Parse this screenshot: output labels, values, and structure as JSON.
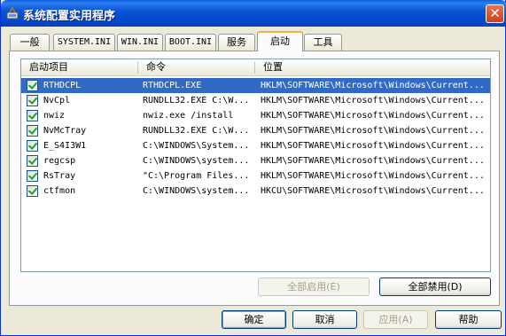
{
  "window": {
    "title": "系统配置实用程序",
    "close_glyph": "✕"
  },
  "tabs": [
    {
      "label": "一般"
    },
    {
      "label": "SYSTEM.INI"
    },
    {
      "label": "WIN.INI"
    },
    {
      "label": "BOOT.INI"
    },
    {
      "label": "服务"
    },
    {
      "label": "启动",
      "active": true
    },
    {
      "label": "工具"
    }
  ],
  "startup_list": {
    "columns": [
      "启动项目",
      "命令",
      "位置"
    ],
    "rows": [
      {
        "item": "RTHDCPL",
        "command": "RTHDCPL.EXE",
        "location": "HKLM\\SOFTWARE\\Microsoft\\Windows\\Current...",
        "checked": true,
        "selected": true
      },
      {
        "item": "NvCpl",
        "command": "RUNDLL32.EXE C:\\W...",
        "location": "HKLM\\SOFTWARE\\Microsoft\\Windows\\Current...",
        "checked": true
      },
      {
        "item": "nwiz",
        "command": "nwiz.exe /install",
        "location": "HKLM\\SOFTWARE\\Microsoft\\Windows\\Current...",
        "checked": true
      },
      {
        "item": "NvMcTray",
        "command": "RUNDLL32.EXE C:\\W...",
        "location": "HKLM\\SOFTWARE\\Microsoft\\Windows\\Current...",
        "checked": true
      },
      {
        "item": "E_S4I3W1",
        "command": "C:\\WINDOWS\\System...",
        "location": "HKLM\\SOFTWARE\\Microsoft\\Windows\\Current...",
        "checked": true
      },
      {
        "item": "regcsp",
        "command": "C:\\WINDOWS\\system...",
        "location": "HKLM\\SOFTWARE\\Microsoft\\Windows\\Current...",
        "checked": true
      },
      {
        "item": "RsTray",
        "command": "\"C:\\Program Files...",
        "location": "HKLM\\SOFTWARE\\Microsoft\\Windows\\Current...",
        "checked": true
      },
      {
        "item": "ctfmon",
        "command": "C:\\WINDOWS\\system...",
        "location": "HKCU\\SOFTWARE\\Microsoft\\Windows\\Current...",
        "checked": true
      }
    ]
  },
  "buttons": {
    "enable_all": "全部启用(E)",
    "disable_all": "全部禁用(D)",
    "ok": "确定",
    "cancel": "取消",
    "apply": "应用(A)",
    "help": "帮助"
  },
  "colors": {
    "title_bar": "#0a55d6",
    "selection": "#316ac5",
    "dialog_bg": "#ece9d8",
    "close_button": "#c8421c"
  }
}
